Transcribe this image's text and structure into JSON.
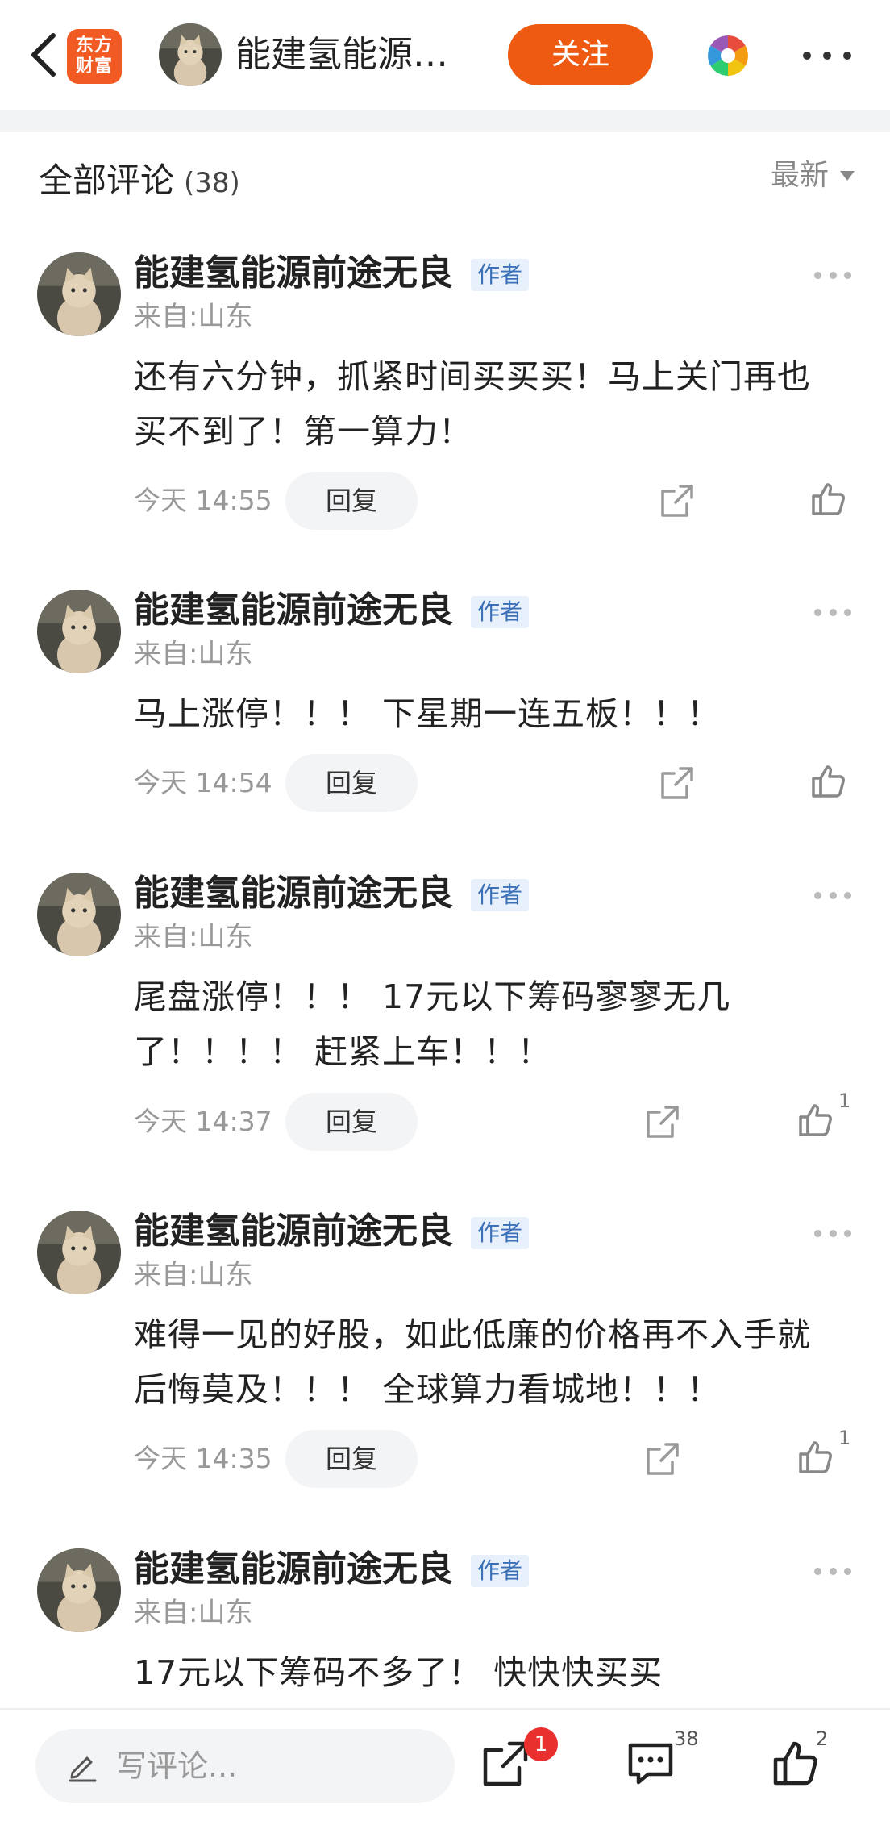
{
  "topbar": {
    "logo_line1": "东方",
    "logo_line2": "财富",
    "title": "能建氢能源…",
    "follow_label": "关注"
  },
  "header": {
    "title": "全部评论",
    "count": "(38)",
    "sort_label": "最新"
  },
  "comments": [
    {
      "author": "能建氢能源前途无良",
      "badge": "作者",
      "location": "来自:山东",
      "text": "还有六分钟，抓紧时间买买买！马上关门再也买不到了！第一算力！",
      "time": "今天 14:55",
      "reply_label": "回复",
      "likes": ""
    },
    {
      "author": "能建氢能源前途无良",
      "badge": "作者",
      "location": "来自:山东",
      "text": "马上涨停！！！ 下星期一连五板！！！",
      "time": "今天 14:54",
      "reply_label": "回复",
      "likes": ""
    },
    {
      "author": "能建氢能源前途无良",
      "badge": "作者",
      "location": "来自:山东",
      "text": "尾盘涨停！！！ 17元以下筹码寥寥无几了！！！！ 赶紧上车！！！",
      "time": "今天 14:37",
      "reply_label": "回复",
      "likes": "1"
    },
    {
      "author": "能建氢能源前途无良",
      "badge": "作者",
      "location": "来自:山东",
      "text": "难得一见的好股，如此低廉的价格再不入手就后悔莫及！！！ 全球算力看城地！！！",
      "time": "今天 14:35",
      "reply_label": "回复",
      "likes": "1"
    },
    {
      "author": "能建氢能源前途无良",
      "badge": "作者",
      "location": "来自:山东",
      "text": "17元以下筹码不多了！ 快快快买买",
      "time": "",
      "reply_label": "",
      "likes": ""
    }
  ],
  "bottombar": {
    "placeholder": "写评论...",
    "share_badge": "1",
    "comment_count": "38",
    "like_count": "2"
  },
  "icons": {
    "back": "chevron-left-icon",
    "share": "share-icon",
    "like": "thumbs-up-icon",
    "comment": "comment-icon",
    "pencil": "pencil-icon",
    "more": "more-dots-icon"
  },
  "colors": {
    "accent": "#ee5a11",
    "badge_bg": "#e7f0fb",
    "badge_text": "#3b6fb6",
    "notify": "#e9302e"
  }
}
